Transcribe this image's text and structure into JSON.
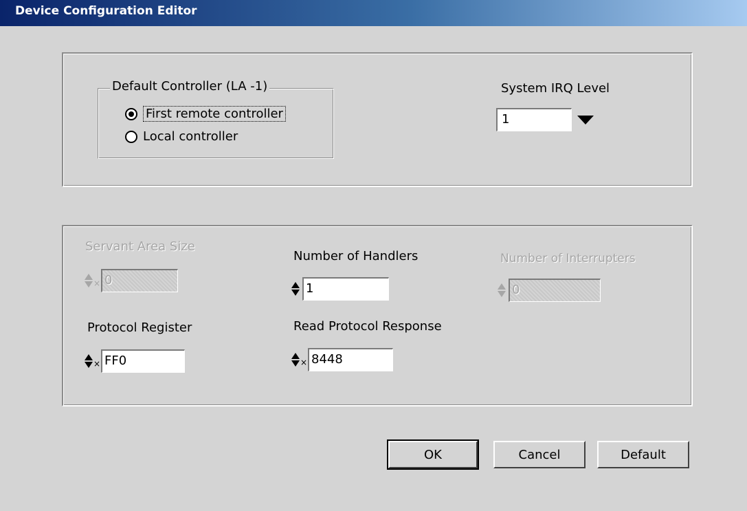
{
  "window": {
    "title": "Device Configuration Editor"
  },
  "controller_group": {
    "legend": "Default Controller (LA -1)",
    "options": [
      {
        "label": "First remote controller",
        "selected": true
      },
      {
        "label": "Local controller",
        "selected": false
      }
    ]
  },
  "irq": {
    "label": "System IRQ Level",
    "value": "1"
  },
  "fields": {
    "servant_area": {
      "label": "Servant Area Size",
      "value": "0",
      "disabled": true
    },
    "handlers": {
      "label": "Number of Handlers",
      "value": "1",
      "disabled": false
    },
    "interrupters": {
      "label": "Number of Interrupters",
      "value": "0",
      "disabled": true
    },
    "protocol_register": {
      "label": "Protocol Register",
      "value": "FF0",
      "prefix": "×"
    },
    "read_protocol": {
      "label": "Read Protocol Response",
      "value": "8448",
      "prefix": "×"
    }
  },
  "buttons": {
    "ok": "OK",
    "cancel": "Cancel",
    "default": "Default"
  }
}
